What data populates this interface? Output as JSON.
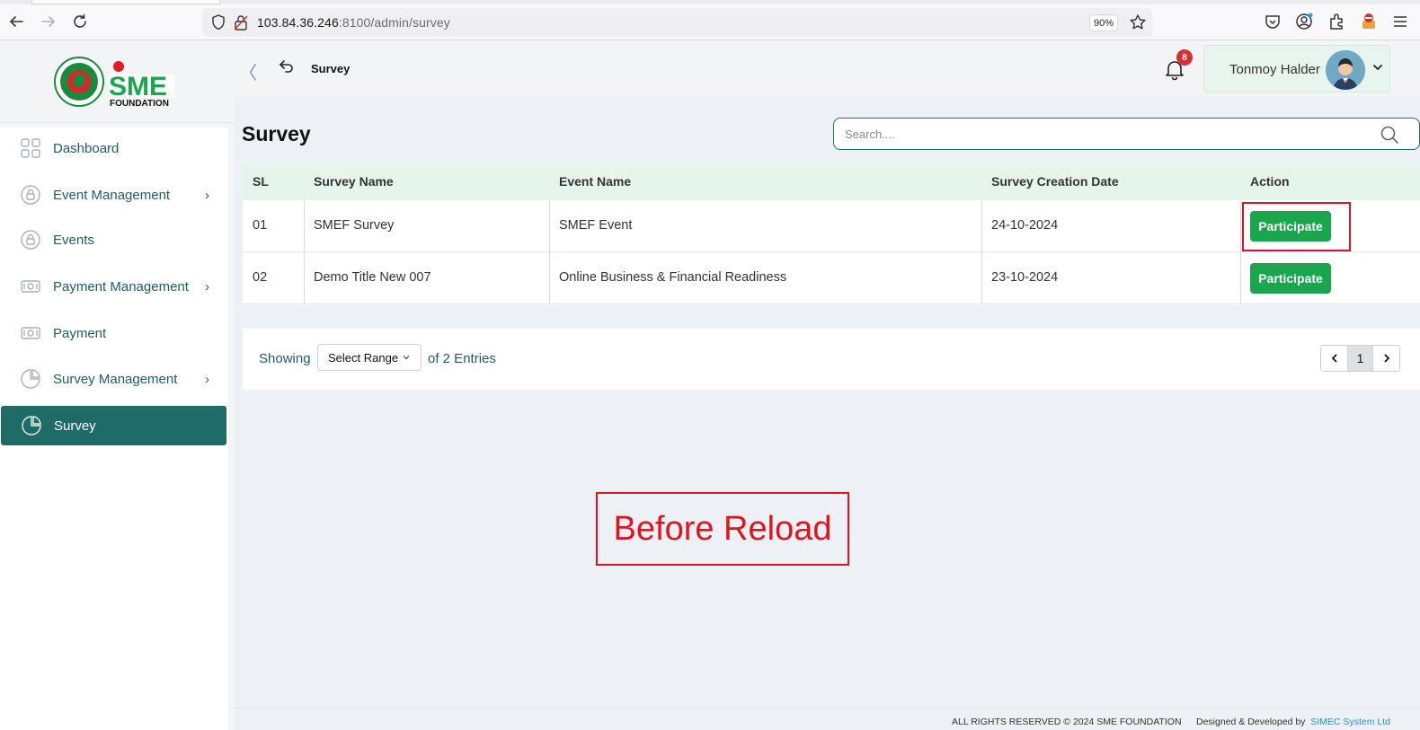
{
  "browser": {
    "url_host": "103.84.36.246",
    "url_port_path": ":8100/admin/survey",
    "zoom": "90%"
  },
  "sidebar": {
    "logo_text": "SME",
    "logo_subtext": "FOUNDATION",
    "items": [
      {
        "label": "Dashboard",
        "icon": "grid-icon",
        "has_submenu": false,
        "active": false
      },
      {
        "label": "Event Management",
        "icon": "lock-circle-icon",
        "has_submenu": true,
        "active": false
      },
      {
        "label": "Events",
        "icon": "lock-circle-icon",
        "has_submenu": false,
        "active": false
      },
      {
        "label": "Payment Management",
        "icon": "money-icon",
        "has_submenu": true,
        "active": false
      },
      {
        "label": "Payment",
        "icon": "money-icon",
        "has_submenu": false,
        "active": false
      },
      {
        "label": "Survey Management",
        "icon": "pie-chart-icon",
        "has_submenu": true,
        "active": false
      },
      {
        "label": "Survey",
        "icon": "pie-chart-icon",
        "has_submenu": false,
        "active": true
      }
    ],
    "chevron": "›"
  },
  "header": {
    "collapse_glyph": "〈",
    "title": "Survey",
    "notification_count": "8",
    "user_name": "Tonmoy Halder"
  },
  "main": {
    "page_title": "Survey",
    "search_placeholder": "Search....",
    "table": {
      "columns": [
        "SL",
        "Survey Name",
        "Event Name",
        "Survey Creation Date",
        "Action"
      ],
      "rows": [
        {
          "sl": "01",
          "survey_name": "SMEF Survey",
          "event_name": "SMEF Event",
          "date": "24-10-2024",
          "action": "Participate"
        },
        {
          "sl": "02",
          "survey_name": "Demo Title New 007",
          "event_name": "Online Business & Financial Readiness",
          "date": "23-10-2024",
          "action": "Participate"
        }
      ]
    },
    "pagination": {
      "showing_label": "Showing",
      "range_select": "Select Range",
      "entries_label": "of 2 Entries",
      "current_page": "1"
    }
  },
  "annotation": {
    "text": "Before Reload",
    "color": "#e0141e"
  },
  "footer": {
    "copyright": "ALL RIGHTS RESERVED © 2024 SME FOUNDATION",
    "designed_by": "Designed & Developed by",
    "developer": "SIMEC System Ltd"
  },
  "colors": {
    "primary": "#1f6b67",
    "button_green": "#1aa64d",
    "table_header_bg": "#e6f5ec",
    "badge_red": "#d63131"
  }
}
